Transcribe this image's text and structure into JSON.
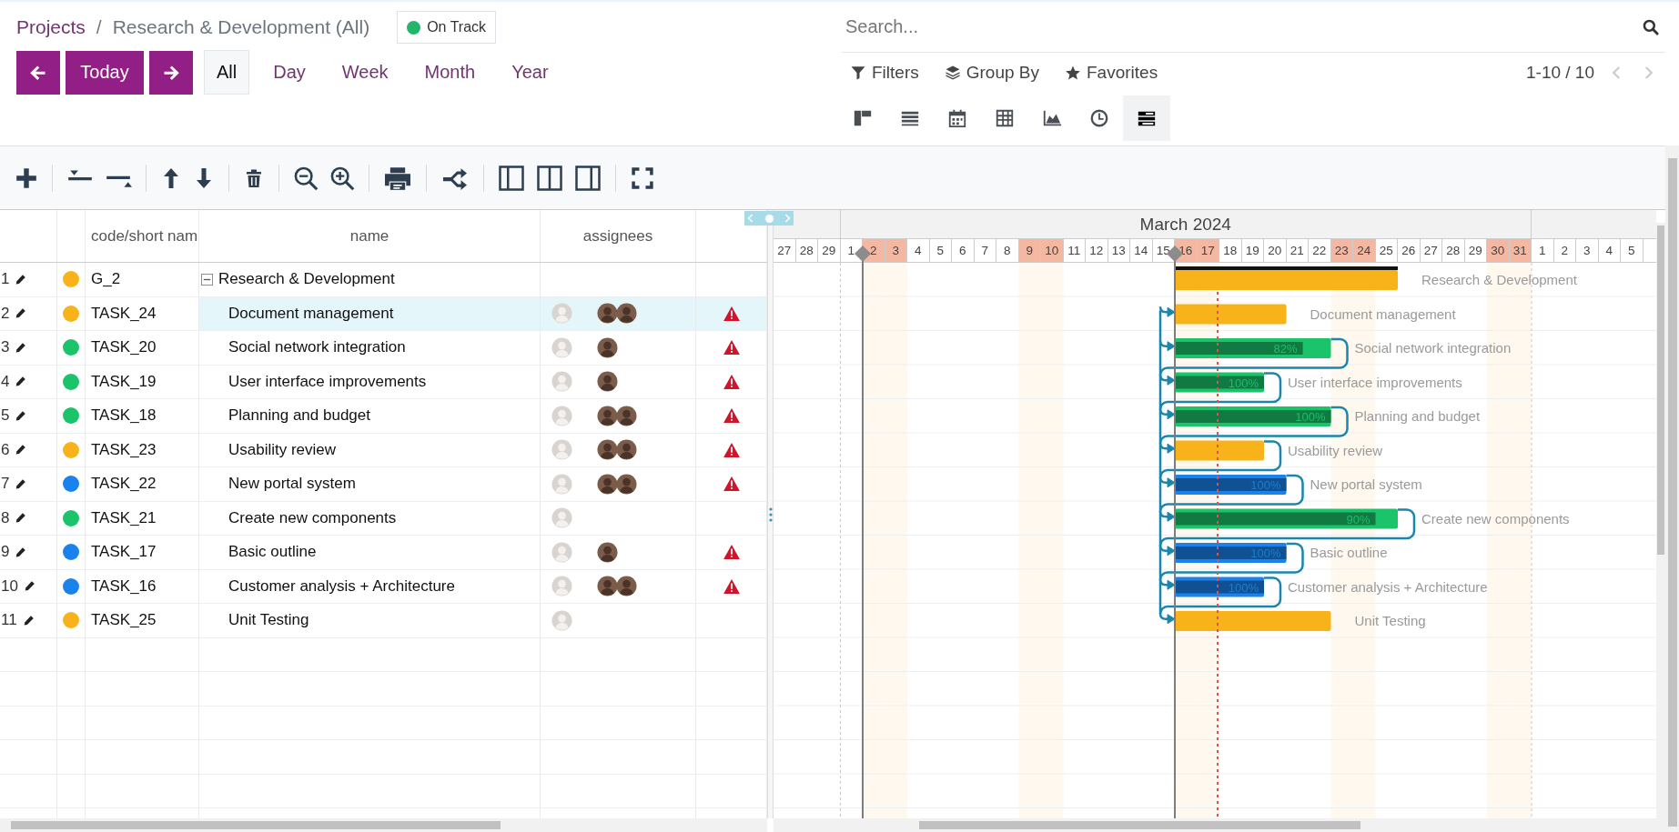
{
  "breadcrumb": [
    {
      "label": "Projects",
      "kind": "link"
    },
    {
      "label": "/",
      "kind": "separator"
    },
    {
      "label": "Research & Development (All)",
      "kind": "current"
    }
  ],
  "status": {
    "label": "On Track",
    "color": "#21b66a"
  },
  "today_button": "Today",
  "scales": [
    {
      "label": "All",
      "selected": true
    },
    {
      "label": "Day",
      "selected": false
    },
    {
      "label": "Week",
      "selected": false
    },
    {
      "label": "Month",
      "selected": false
    },
    {
      "label": "Year",
      "selected": false
    }
  ],
  "search": {
    "placeholder": "Search..."
  },
  "search_options": [
    {
      "label": "Filters",
      "kind": "filter"
    },
    {
      "label": "Group By",
      "kind": "group"
    },
    {
      "label": "Favorites",
      "kind": "favorite"
    }
  ],
  "pager": {
    "text": "1-10 / 10"
  },
  "views": [
    {
      "kind": "kanban",
      "selected": false
    },
    {
      "kind": "list",
      "selected": false
    },
    {
      "kind": "calendar",
      "selected": false
    },
    {
      "kind": "pivot",
      "selected": false
    },
    {
      "kind": "graph",
      "selected": false
    },
    {
      "kind": "activity",
      "selected": false
    },
    {
      "kind": "gantt",
      "selected": true
    }
  ],
  "columns": [
    {
      "kind": "number"
    },
    {
      "kind": "status"
    },
    {
      "kind": "code",
      "label": "code/short nam"
    },
    {
      "kind": "name",
      "label": "name"
    },
    {
      "kind": "assignees",
      "label": "assignees"
    },
    {
      "kind": "warning"
    }
  ],
  "timeline": {
    "segments": [
      {
        "kind": "before",
        "days": [
          {
            "label": "27",
            "weekend": false,
            "milestone": false,
            "today": false
          },
          {
            "label": "28",
            "weekend": false,
            "milestone": false,
            "today": false
          },
          {
            "label": "29",
            "weekend": false,
            "milestone": false,
            "today": false
          }
        ]
      },
      {
        "kind": "month",
        "label": "March 2024",
        "days": [
          {
            "label": "1",
            "weekend": false,
            "milestone": false,
            "today": false
          },
          {
            "label": "2",
            "weekend": true,
            "milestone": true,
            "today": false
          },
          {
            "label": "3",
            "weekend": true,
            "milestone": false,
            "today": false
          },
          {
            "label": "4",
            "weekend": false,
            "milestone": false,
            "today": false
          },
          {
            "label": "5",
            "weekend": false,
            "milestone": false,
            "today": false
          },
          {
            "label": "6",
            "weekend": false,
            "milestone": false,
            "today": false
          },
          {
            "label": "7",
            "weekend": false,
            "milestone": false,
            "today": false
          },
          {
            "label": "8",
            "weekend": false,
            "milestone": false,
            "today": false
          },
          {
            "label": "9",
            "weekend": true,
            "milestone": false,
            "today": false
          },
          {
            "label": "10",
            "weekend": true,
            "milestone": false,
            "today": false
          },
          {
            "label": "11",
            "weekend": false,
            "milestone": false,
            "today": false
          },
          {
            "label": "12",
            "weekend": false,
            "milestone": false,
            "today": false
          },
          {
            "label": "13",
            "weekend": false,
            "milestone": false,
            "today": false
          },
          {
            "label": "14",
            "weekend": false,
            "milestone": false,
            "today": false
          },
          {
            "label": "15",
            "weekend": false,
            "milestone": false,
            "today": false
          },
          {
            "label": "16",
            "weekend": true,
            "milestone": true,
            "today": false
          },
          {
            "label": "17",
            "weekend": true,
            "milestone": false,
            "today": false
          },
          {
            "label": "18",
            "weekend": false,
            "milestone": false,
            "today": true
          },
          {
            "label": "19",
            "weekend": false,
            "milestone": false,
            "today": false
          },
          {
            "label": "20",
            "weekend": false,
            "milestone": false,
            "today": false
          },
          {
            "label": "21",
            "weekend": false,
            "milestone": false,
            "today": false
          },
          {
            "label": "22",
            "weekend": false,
            "milestone": false,
            "today": false
          },
          {
            "label": "23",
            "weekend": true,
            "milestone": false,
            "today": false
          },
          {
            "label": "24",
            "weekend": true,
            "milestone": false,
            "today": false
          },
          {
            "label": "25",
            "weekend": false,
            "milestone": false,
            "today": false
          },
          {
            "label": "26",
            "weekend": false,
            "milestone": false,
            "today": false
          },
          {
            "label": "27",
            "weekend": false,
            "milestone": false,
            "today": false
          },
          {
            "label": "28",
            "weekend": false,
            "milestone": false,
            "today": false
          },
          {
            "label": "29",
            "weekend": false,
            "milestone": false,
            "today": false
          },
          {
            "label": "30",
            "weekend": true,
            "milestone": false,
            "today": false
          },
          {
            "label": "31",
            "weekend": true,
            "milestone": false,
            "today": false
          }
        ]
      },
      {
        "kind": "after",
        "days": [
          {
            "label": "1",
            "weekend": false,
            "milestone": false,
            "today": false
          },
          {
            "label": "2",
            "weekend": false,
            "milestone": false,
            "today": false
          },
          {
            "label": "3",
            "weekend": false,
            "milestone": false,
            "today": false
          },
          {
            "label": "4",
            "weekend": false,
            "milestone": false,
            "today": false
          },
          {
            "label": "5",
            "weekend": false,
            "milestone": false,
            "today": false
          }
        ]
      }
    ]
  },
  "tasks": [
    {
      "number": "1",
      "color": "#f8b31b",
      "code": "G_2",
      "name": "Research & Development",
      "kind": "group",
      "expanded": true,
      "selected": false,
      "bar": {
        "caption": "Research & Development"
      },
      "children": [
        {
          "number": "2",
          "color": "#f8b31b",
          "code": "TASK_24",
          "name": "Document management",
          "kind": "task",
          "selected": true,
          "assignees": [
            {
              "kind": "placeholder"
            },
            {
              "kind": "photo"
            },
            {
              "kind": "photo"
            }
          ],
          "warning": true,
          "dependency": false,
          "bar": {
            "caption": "Document management"
          }
        },
        {
          "number": "3",
          "color": "#1bc46a",
          "code": "TASK_20",
          "name": "Social network integration",
          "kind": "task",
          "selected": false,
          "assignees": [
            {
              "kind": "placeholder"
            },
            {
              "kind": "photo"
            }
          ],
          "warning": true,
          "dependency": true,
          "bar": {
            "level": 0.82,
            "label": "82%",
            "caption": "Social network integration"
          }
        },
        {
          "number": "4",
          "color": "#1bc46a",
          "code": "TASK_19",
          "name": "User interface improvements",
          "kind": "task",
          "selected": false,
          "assignees": [
            {
              "kind": "placeholder"
            },
            {
              "kind": "photo"
            }
          ],
          "warning": true,
          "dependency": true,
          "bar": {
            "level": 1,
            "label": "100%",
            "caption": "User interface improvements"
          }
        },
        {
          "number": "5",
          "color": "#1bc46a",
          "code": "TASK_18",
          "name": "Planning and budget",
          "kind": "task",
          "selected": false,
          "assignees": [
            {
              "kind": "placeholder"
            },
            {
              "kind": "photo"
            },
            {
              "kind": "photo"
            }
          ],
          "warning": true,
          "dependency": true,
          "bar": {
            "level": 1,
            "label": "100%",
            "caption": "Planning and budget"
          }
        },
        {
          "number": "6",
          "color": "#f8b31b",
          "code": "TASK_23",
          "name": "Usability review",
          "kind": "task",
          "selected": false,
          "assignees": [
            {
              "kind": "placeholder"
            },
            {
              "kind": "photo"
            },
            {
              "kind": "photo"
            }
          ],
          "warning": true,
          "dependency": true,
          "bar": {
            "caption": "Usability review"
          }
        },
        {
          "number": "7",
          "color": "#1a82ed",
          "code": "TASK_22",
          "name": "New portal system",
          "kind": "task",
          "selected": false,
          "assignees": [
            {
              "kind": "placeholder"
            },
            {
              "kind": "photo"
            },
            {
              "kind": "photo"
            }
          ],
          "warning": true,
          "dependency": true,
          "bar": {
            "level": 1,
            "label": "100%",
            "caption": "New portal system"
          }
        },
        {
          "number": "8",
          "color": "#1bc46a",
          "code": "TASK_21",
          "name": "Create new components",
          "kind": "task",
          "selected": false,
          "assignees": [
            {
              "kind": "placeholder"
            }
          ],
          "warning": false,
          "dependency": true,
          "bar": {
            "level": 0.9,
            "label": "90%",
            "caption": "Create new components"
          }
        },
        {
          "number": "9",
          "color": "#1a82ed",
          "code": "TASK_17",
          "name": "Basic outline",
          "kind": "task",
          "selected": false,
          "assignees": [
            {
              "kind": "placeholder"
            },
            {
              "kind": "photo"
            }
          ],
          "warning": true,
          "dependency": true,
          "bar": {
            "level": 1,
            "label": "100%",
            "caption": "Basic outline"
          }
        },
        {
          "number": "10",
          "color": "#1a82ed",
          "code": "TASK_16",
          "name": "Customer analysis + Architecture",
          "kind": "task",
          "selected": false,
          "assignees": [
            {
              "kind": "placeholder"
            },
            {
              "kind": "photo"
            },
            {
              "kind": "photo"
            }
          ],
          "warning": true,
          "dependency": true,
          "bar": {
            "level": 1,
            "label": "100%",
            "caption": "Customer analysis + Architecture"
          }
        },
        {
          "number": "11",
          "color": "#f8b31b",
          "code": "TASK_25",
          "name": "Unit Testing",
          "kind": "task",
          "selected": false,
          "assignees": [
            {
              "kind": "placeholder"
            }
          ],
          "warning": false,
          "dependency": false,
          "bar": {
            "caption": "Unit Testing"
          }
        }
      ]
    }
  ]
}
